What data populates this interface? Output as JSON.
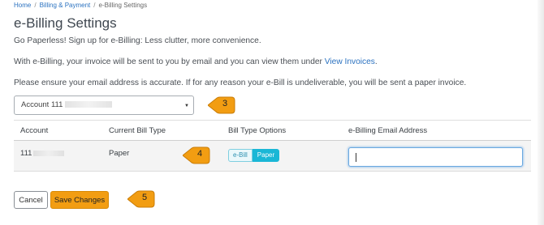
{
  "breadcrumb": {
    "home": "Home",
    "billing": "Billing & Payment",
    "current": "e-Billing Settings",
    "separator": "/"
  },
  "page_title": "e-Billing Settings",
  "intro": {
    "line1": "Go Paperless! Sign up for e-Billing: Less clutter, more convenience.",
    "line2_prefix": "With e-Billing, your invoice will be sent to you by email and you can view them under ",
    "line2_link": "View Invoices",
    "line2_suffix": ".",
    "line3": "Please ensure your email address is accurate. If for any reason your e-Bill is undeliverable, you will be sent a paper invoice."
  },
  "account_select": {
    "value": "Account 111",
    "caret": "▼"
  },
  "callouts": {
    "c3": "3",
    "c4": "4",
    "c5": "5",
    "color": "#f29d12"
  },
  "table": {
    "headers": {
      "account": "Account",
      "current_bill_type": "Current Bill Type",
      "bill_type_options": "Bill Type Options",
      "email": "e-Billing Email Address"
    },
    "row": {
      "account": "111",
      "current_bill_type": "Paper",
      "option_ebill": "e-Bill",
      "option_paper": "Paper",
      "selected_option": "Paper",
      "email_value": ""
    }
  },
  "buttons": {
    "cancel": "Cancel",
    "save": "Save Changes"
  },
  "colors": {
    "link": "#2b72c0",
    "accent": "#f29d12",
    "toggle_on": "#1ab7d6"
  }
}
